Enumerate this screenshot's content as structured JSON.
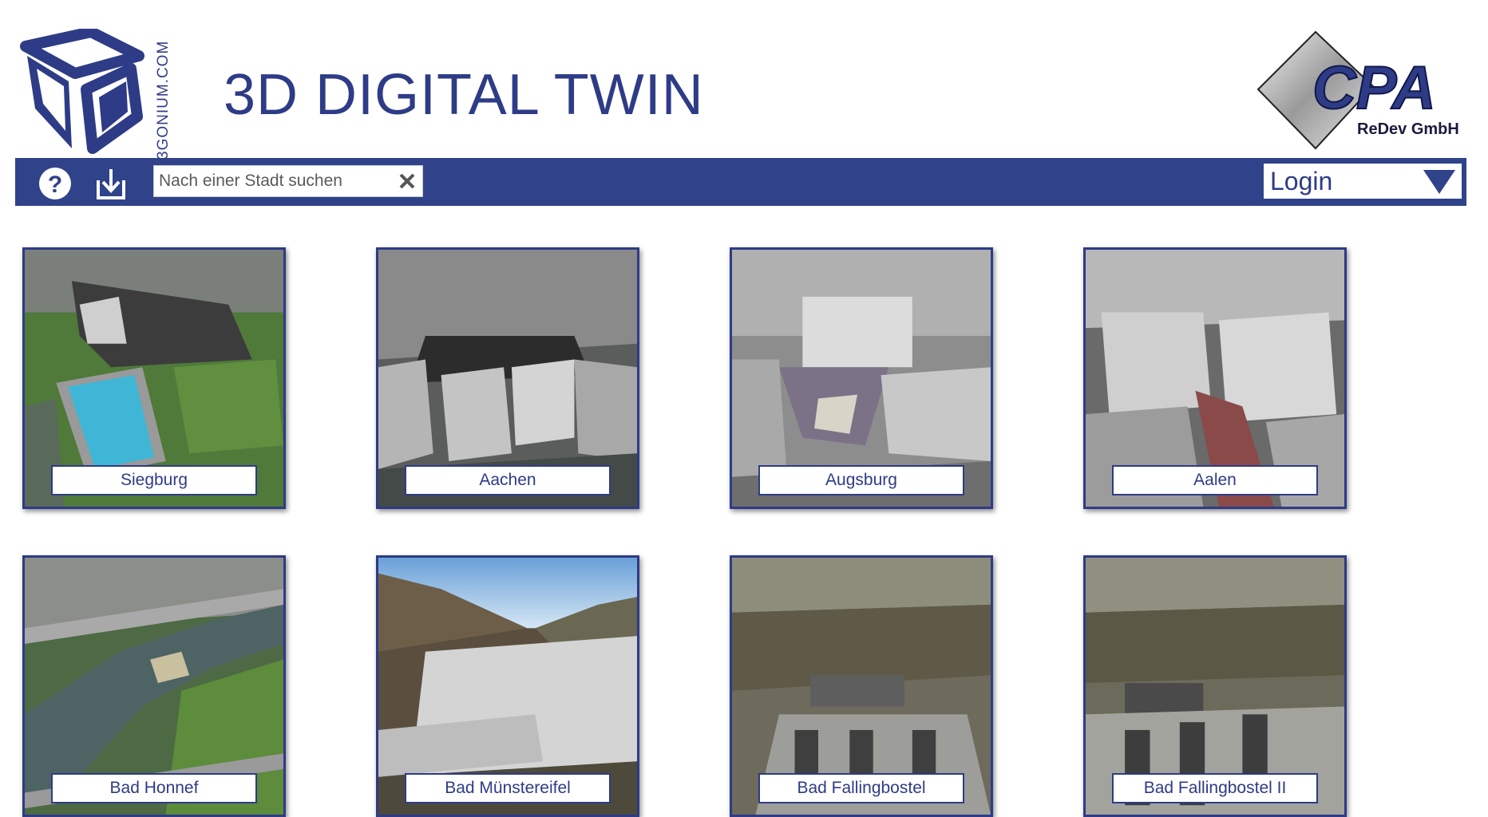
{
  "app": {
    "title": "3D DIGITAL TWIN",
    "brand_left": "3GONIUM.COM",
    "brand_right_name": "CPA",
    "brand_right_sub": "ReDev GmbH"
  },
  "toolbar": {
    "help_icon": "help-circle-icon",
    "download_icon": "download-icon",
    "search_placeholder": "Nach einer Stadt suchen",
    "search_value": "",
    "clear_icon": "close-icon",
    "login_label": "Login",
    "login_caret_icon": "caret-down-icon"
  },
  "colors": {
    "brand_blue": "#304289",
    "title_blue": "#2e3b86",
    "background": "#ffffff"
  },
  "cities": [
    {
      "label": "Siegburg",
      "scene": "pool"
    },
    {
      "label": "Aachen",
      "scene": "dense"
    },
    {
      "label": "Augsburg",
      "scene": "square"
    },
    {
      "label": "Aalen",
      "scene": "street"
    },
    {
      "label": "Bad Honnef",
      "scene": "river"
    },
    {
      "label": "Bad Münstereifel",
      "scene": "valley"
    },
    {
      "label": "Bad Fallingbostel",
      "scene": "forest"
    },
    {
      "label": "Bad Fallingbostel II",
      "scene": "barracks"
    }
  ]
}
